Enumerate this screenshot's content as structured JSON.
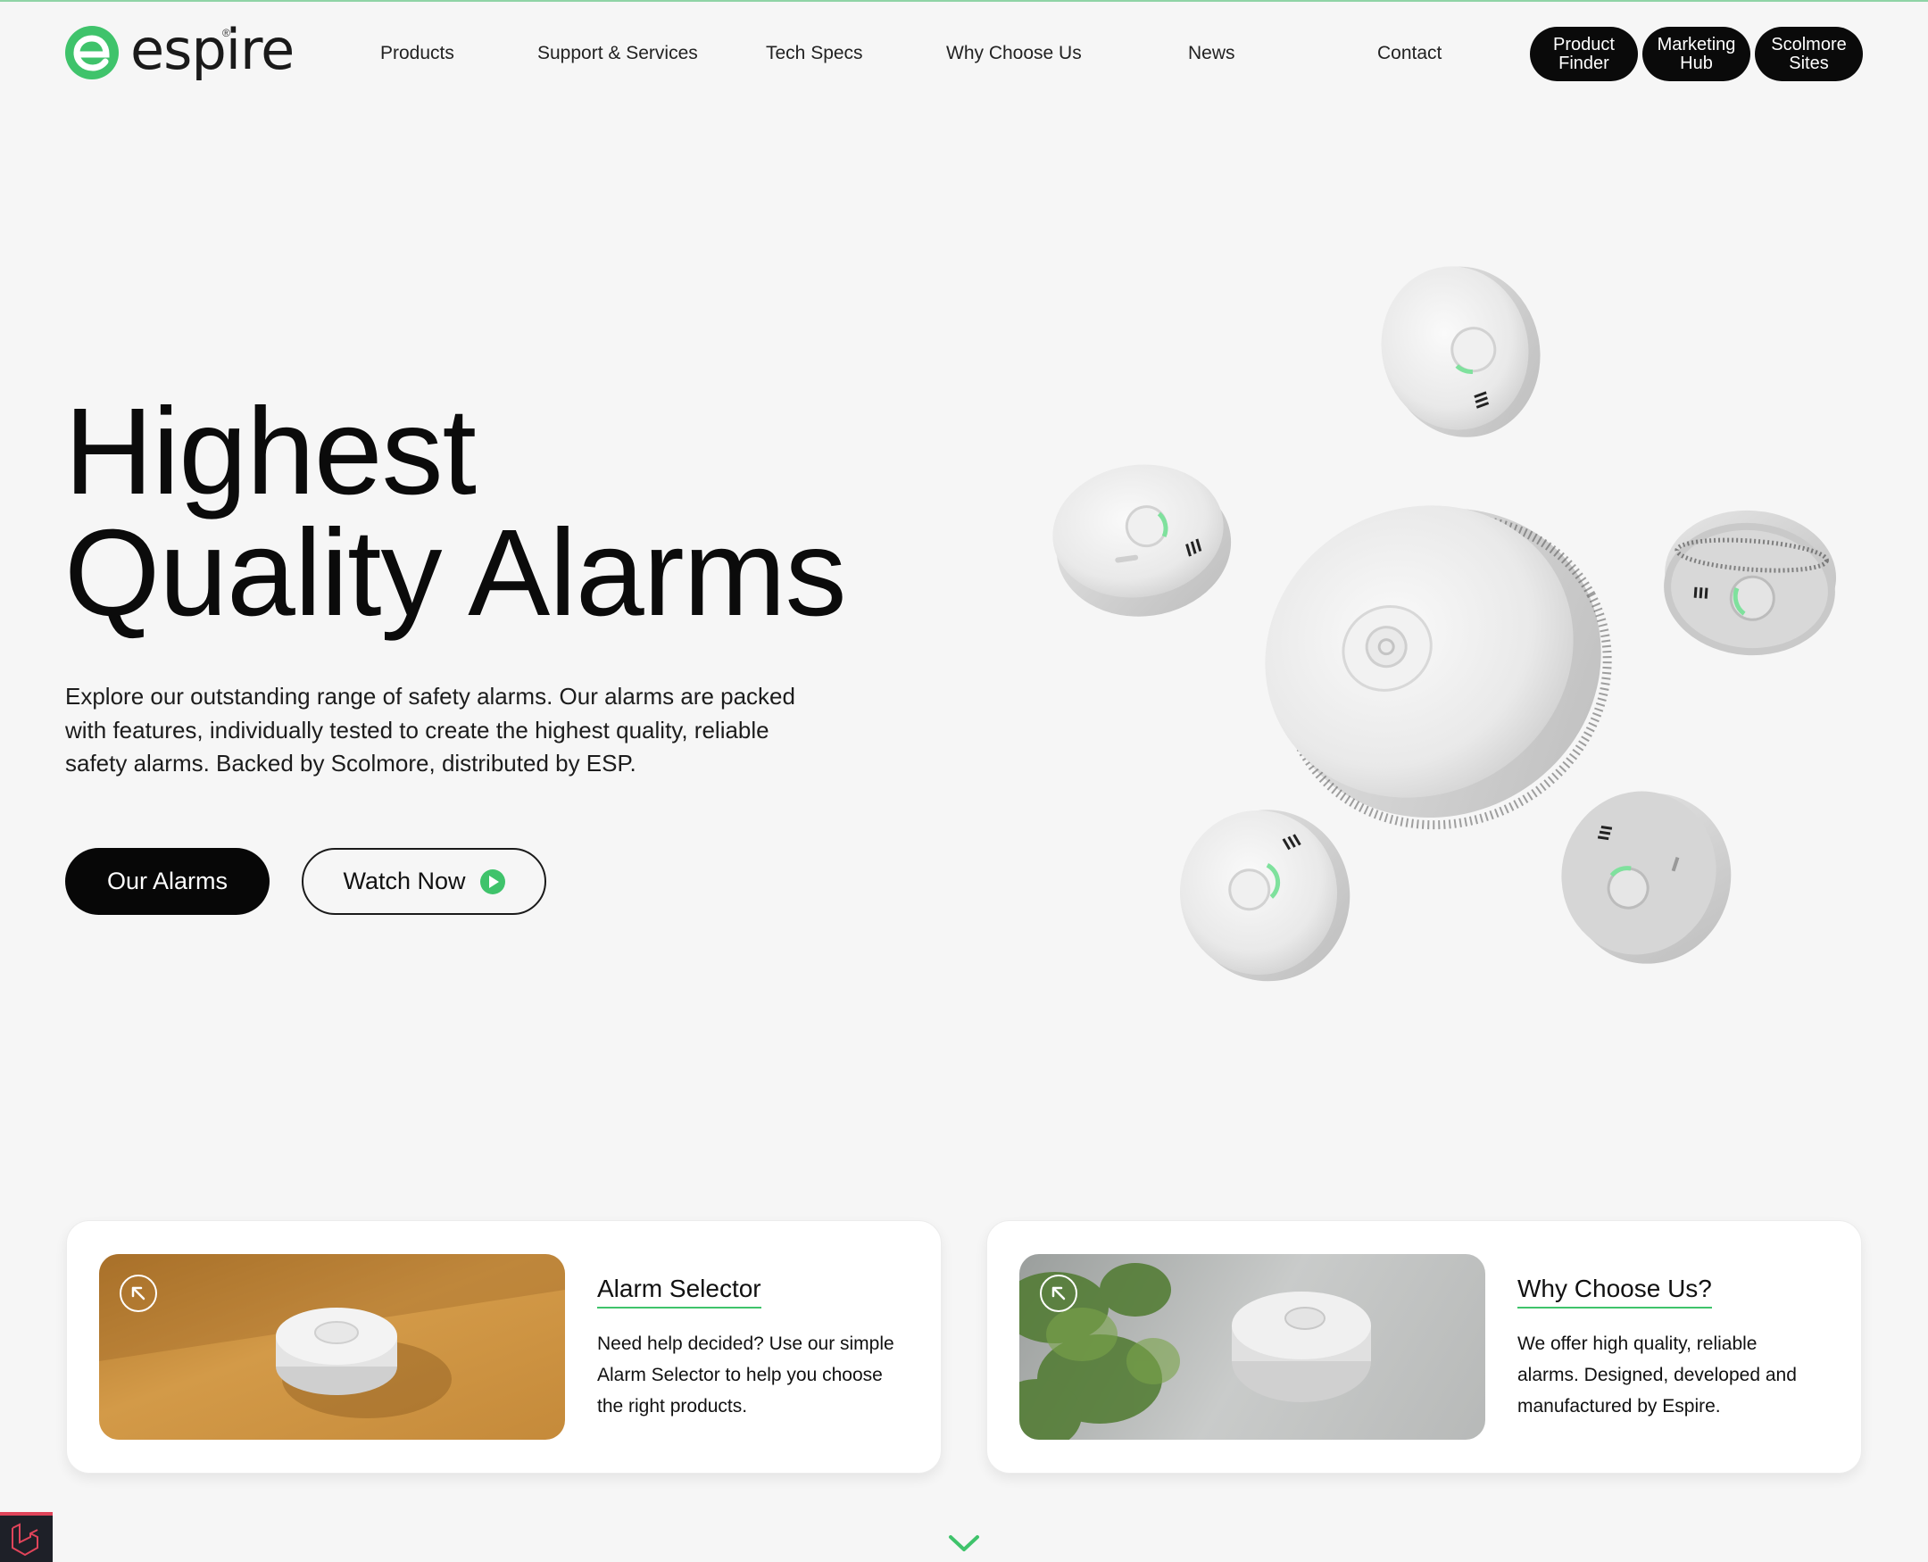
{
  "brand": {
    "name": "espire",
    "registered": "®",
    "accent": "#3fc36b"
  },
  "nav": {
    "items": [
      "Products",
      "Support & Services",
      "Tech Specs",
      "Why Choose Us",
      "News",
      "Contact"
    ]
  },
  "pills": [
    {
      "line1": "Product",
      "line2": "Finder"
    },
    {
      "line1": "Marketing",
      "line2": "Hub"
    },
    {
      "line1": "Scolmore",
      "line2": "Sites"
    }
  ],
  "hero": {
    "title_line1": "Highest",
    "title_line2": "Quality Alarms",
    "description": "Explore our outstanding range of safety alarms. Our alarms are packed with features, individually tested to create the highest quality, reliable safety alarms. Backed by Scolmore, distributed by ESP.",
    "primary_label": "Our Alarms",
    "secondary_label": "Watch Now"
  },
  "cards": [
    {
      "title": "Alarm Selector",
      "text": "Need help decided? Use our simple Alarm Selector to help you choose the right products.",
      "image_bg": "#c88f3f"
    },
    {
      "title": "Why Choose Us?",
      "text": "We offer high quality, reliable alarms. Designed, developed and manufactured by Espire.",
      "image_bg": "#b9bcbc"
    }
  ],
  "icons": {
    "play": "play-icon",
    "card_arrow": "arrow-up-left-icon",
    "scroll": "chevron-down-icon",
    "corner": "laravel-icon"
  }
}
